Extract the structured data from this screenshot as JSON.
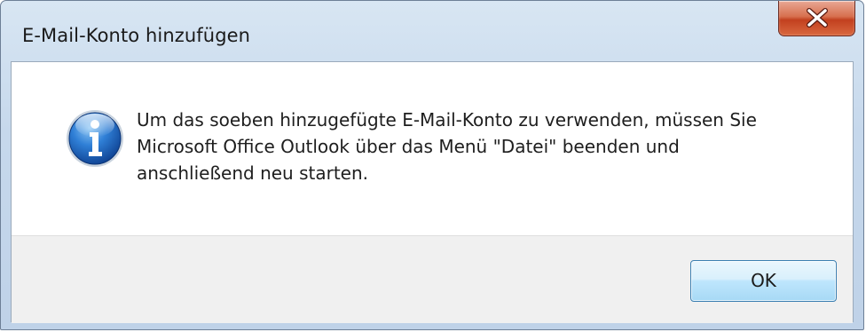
{
  "window": {
    "title": "E-Mail-Konto hinzufügen"
  },
  "dialog": {
    "icon": "info-icon",
    "message": "Um das soeben hinzugefügte E-Mail-Konto zu verwenden, müssen Sie\nMicrosoft Office Outlook über das Menü \"Datei\" beenden und\nanschließend neu starten.",
    "ok_label": "OK"
  },
  "colors": {
    "titlebar": "#c6d8ec",
    "close_button": "#c2401f",
    "ok_button": "#bee6fd",
    "footer": "#f0f0f0"
  }
}
